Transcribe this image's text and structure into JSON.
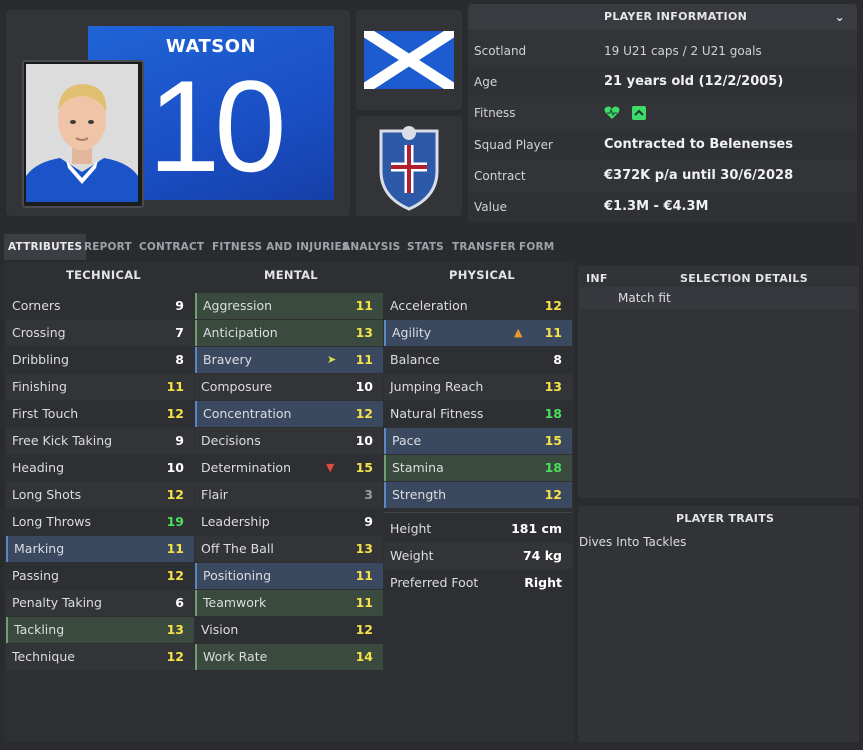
{
  "player": {
    "name": "WATSON",
    "number": "10"
  },
  "info": {
    "title": "PLAYER INFORMATION",
    "rows": [
      {
        "label": "Scotland",
        "value": "19 U21 caps / 2 U21 goals"
      },
      {
        "label": "Age",
        "value": "21 years old (12/2/2005)"
      },
      {
        "label": "Fitness",
        "value": ""
      },
      {
        "label": "Squad Player",
        "value": "Contracted to Belenenses"
      },
      {
        "label": "Contract",
        "value": "€372K p/a until 30/6/2028"
      },
      {
        "label": "Value",
        "value": "€1.3M - €4.3M"
      }
    ]
  },
  "tabs": [
    "ATTRIBUTES",
    "REPORT",
    "CONTRACT",
    "FITNESS AND INJURIES",
    "ANALYSIS",
    "STATS",
    "TRANSFER",
    "FORM"
  ],
  "columns": {
    "technical": "TECHNICAL",
    "mental": "MENTAL",
    "physical": "PHYSICAL"
  },
  "technical": [
    {
      "name": "Corners",
      "value": "9"
    },
    {
      "name": "Crossing",
      "value": "7"
    },
    {
      "name": "Dribbling",
      "value": "8"
    },
    {
      "name": "Finishing",
      "value": "11"
    },
    {
      "name": "First Touch",
      "value": "12"
    },
    {
      "name": "Free Kick Taking",
      "value": "9"
    },
    {
      "name": "Heading",
      "value": "10"
    },
    {
      "name": "Long Shots",
      "value": "12"
    },
    {
      "name": "Long Throws",
      "value": "19"
    },
    {
      "name": "Marking",
      "value": "11"
    },
    {
      "name": "Passing",
      "value": "12"
    },
    {
      "name": "Penalty Taking",
      "value": "6"
    },
    {
      "name": "Tackling",
      "value": "13"
    },
    {
      "name": "Technique",
      "value": "12"
    }
  ],
  "mental": [
    {
      "name": "Aggression",
      "value": "11"
    },
    {
      "name": "Anticipation",
      "value": "13"
    },
    {
      "name": "Bravery",
      "value": "11"
    },
    {
      "name": "Composure",
      "value": "10"
    },
    {
      "name": "Concentration",
      "value": "12"
    },
    {
      "name": "Decisions",
      "value": "10"
    },
    {
      "name": "Determination",
      "value": "15"
    },
    {
      "name": "Flair",
      "value": "3"
    },
    {
      "name": "Leadership",
      "value": "9"
    },
    {
      "name": "Off The Ball",
      "value": "13"
    },
    {
      "name": "Positioning",
      "value": "11"
    },
    {
      "name": "Teamwork",
      "value": "11"
    },
    {
      "name": "Vision",
      "value": "12"
    },
    {
      "name": "Work Rate",
      "value": "14"
    }
  ],
  "physical": [
    {
      "name": "Acceleration",
      "value": "12"
    },
    {
      "name": "Agility",
      "value": "11"
    },
    {
      "name": "Balance",
      "value": "8"
    },
    {
      "name": "Jumping Reach",
      "value": "13"
    },
    {
      "name": "Natural Fitness",
      "value": "18"
    },
    {
      "name": "Pace",
      "value": "15"
    },
    {
      "name": "Stamina",
      "value": "18"
    },
    {
      "name": "Strength",
      "value": "12"
    }
  ],
  "body": [
    {
      "name": "Height",
      "value": "181 cm"
    },
    {
      "name": "Weight",
      "value": "74 kg"
    },
    {
      "name": "Preferred Foot",
      "value": "Right"
    }
  ],
  "selection": {
    "inf_label": "INF",
    "title": "SELECTION DETAILS",
    "status": "Match fit"
  },
  "traits": {
    "title": "PLAYER TRAITS",
    "items": [
      "Dives Into Tackles"
    ]
  },
  "colors": {
    "shirt_blue": "#1a4fc4",
    "highlight_green": "#3a4a3e",
    "highlight_blue": "#3a4960",
    "value_yellow": "#f6e14a",
    "value_green": "#49e05d"
  }
}
